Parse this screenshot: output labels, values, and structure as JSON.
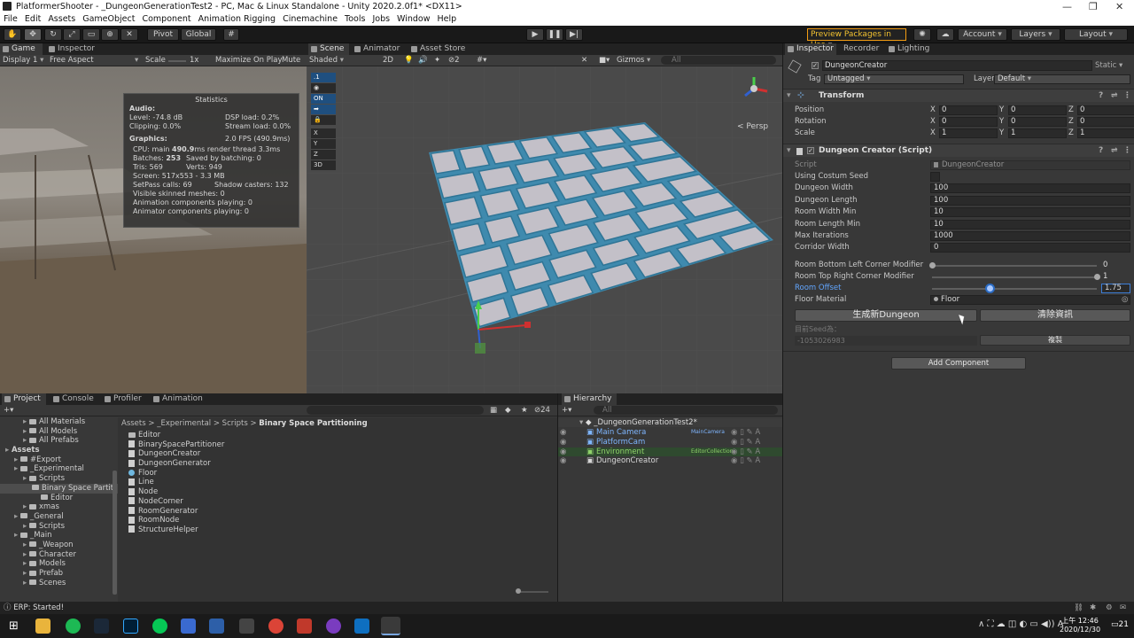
{
  "window": {
    "title": "PlatformerShooter - _DungeonGenerationTest2 - PC, Mac & Linux Standalone - Unity 2020.2.0f1* <DX11>"
  },
  "menu": [
    "File",
    "Edit",
    "Assets",
    "GameObject",
    "Component",
    "Animation Rigging",
    "Cinemachine",
    "Tools",
    "Jobs",
    "Window",
    "Help"
  ],
  "toolbar": {
    "pivot": "Pivot",
    "global": "Global",
    "preview": "Preview Packages in Use",
    "account": "Account",
    "layers": "Layers",
    "layout": "Layout"
  },
  "game": {
    "tabs": [
      "Game",
      "Inspector"
    ],
    "display": "Display 1",
    "aspect": "Free Aspect",
    "scale_label": "Scale",
    "scale_value": "1x",
    "maximize": "Maximize On Play",
    "mute": "Mute A",
    "stats": {
      "title": "Statistics",
      "audio": "Audio:",
      "level": "Level: -74.8 dB",
      "clipping": "Clipping: 0.0%",
      "dsp": "DSP load: 0.2%",
      "stream": "Stream load: 0.0%",
      "graphics": "Graphics:",
      "fps": "2.0 FPS (490.9ms)",
      "cpu_pre": "CPU: main ",
      "cpu_val": "490.9",
      "cpu_post": "ms  render thread 3.3ms",
      "batches_pre": "Batches: ",
      "batches_val": "253",
      "saved": "Saved by batching: 0",
      "tris": "Tris: 569",
      "verts": "Verts: 949",
      "screen": "Screen: 517x553 - 3.3 MB",
      "setpass": "SetPass calls: 69",
      "shadow": "Shadow casters: 132",
      "skinned": "Visible skinned meshes: 0",
      "anim1": "Animation components playing: 0",
      "anim2": "Animator components playing: 0"
    }
  },
  "scene": {
    "tabs": [
      "Scene",
      "Animator",
      "Asset Store"
    ],
    "shading": "Shaded",
    "mode2d": "2D",
    "layers_count": "2",
    "gizmos": "Gizmos",
    "search_placeholder": "All",
    "persp": "Persp",
    "overlay": [
      ".1",
      "",
      "ON",
      "",
      "X",
      "Y",
      "Z",
      "3D"
    ]
  },
  "inspector": {
    "tabs": [
      "Inspector",
      "Recorder",
      "Lighting"
    ],
    "object_name": "DungeonCreator",
    "static": "Static",
    "tag_label": "Tag",
    "tag": "Untagged",
    "layer_label": "Layer",
    "layer": "Default",
    "transform": {
      "title": "Transform",
      "position": "Position",
      "rotation": "Rotation",
      "scale": "Scale",
      "pos": [
        "0",
        "0",
        "0"
      ],
      "rot": [
        "0",
        "0",
        "0"
      ],
      "scl": [
        "1",
        "1",
        "1"
      ],
      "axes": [
        "X",
        "Y",
        "Z"
      ]
    },
    "script_component": {
      "title": "Dungeon Creator (Script)",
      "script_label": "Script",
      "script_value": "DungeonCreator",
      "fields": [
        {
          "label": "Using Costum Seed",
          "value": ""
        },
        {
          "label": "Dungeon Width",
          "value": "100"
        },
        {
          "label": "Dungeon Length",
          "value": "100"
        },
        {
          "label": "Room Width Min",
          "value": "10"
        },
        {
          "label": "Room Length Min",
          "value": "10"
        },
        {
          "label": "Max Iterations",
          "value": "1000"
        },
        {
          "label": "Corridor Width",
          "value": "0"
        }
      ],
      "slider1": {
        "label": "Room Bottom Left Corner Modifier",
        "value": "0",
        "level": 0
      },
      "slider2": {
        "label": "Room Top Right Corner Modifier",
        "value": "1",
        "level": 1
      },
      "slider3": {
        "label": "Room Offset",
        "value": "1.75",
        "level": 0.35
      },
      "floor_label": "Floor Material",
      "floor_value": "Floor",
      "generate": "生成新Dungeon",
      "clear": "清除資訊",
      "seed_label": "目前Seed為：",
      "seed_value": "-1053026983",
      "copy": "複製"
    },
    "add_component": "Add Component"
  },
  "project": {
    "tabs": [
      "Project",
      "Console",
      "Profiler",
      "Animation"
    ],
    "count": "24",
    "breadcrumb": [
      "Assets",
      "_Experimental",
      "Scripts",
      "Binary Space Partitioning"
    ],
    "tree": [
      {
        "t": "All Materials",
        "d": 2
      },
      {
        "t": "All Models",
        "d": 2
      },
      {
        "t": "All Prefabs",
        "d": 2
      },
      {
        "t": "Assets",
        "d": 0,
        "b": true
      },
      {
        "t": "#Export",
        "d": 1
      },
      {
        "t": "_Experimental",
        "d": 1
      },
      {
        "t": "Scripts",
        "d": 2
      },
      {
        "t": "Binary Space Partiti",
        "d": 3,
        "sel": true
      },
      {
        "t": "Editor",
        "d": 4
      },
      {
        "t": "xmas",
        "d": 2
      },
      {
        "t": "_General",
        "d": 1
      },
      {
        "t": "Scripts",
        "d": 2
      },
      {
        "t": "_Main",
        "d": 1
      },
      {
        "t": "_Weapon",
        "d": 2
      },
      {
        "t": "Character",
        "d": 2
      },
      {
        "t": "Models",
        "d": 2
      },
      {
        "t": "Prefab",
        "d": 2
      },
      {
        "t": "Scenes",
        "d": 2
      }
    ],
    "files": [
      {
        "t": "Editor",
        "k": "folder"
      },
      {
        "t": "BinarySpacePartitioner",
        "k": "script"
      },
      {
        "t": "DungeonCreator",
        "k": "script"
      },
      {
        "t": "DungeonGenerator",
        "k": "script"
      },
      {
        "t": "Floor",
        "k": "mat"
      },
      {
        "t": "Line",
        "k": "script"
      },
      {
        "t": "Node",
        "k": "script"
      },
      {
        "t": "NodeCorner",
        "k": "script"
      },
      {
        "t": "RoomGenerator",
        "k": "script"
      },
      {
        "t": "RoomNode",
        "k": "script"
      },
      {
        "t": "StructureHelper",
        "k": "script"
      }
    ]
  },
  "hierarchy": {
    "title": "Hierarchy",
    "search_placeholder": "All",
    "scene": "_DungeonGenerationTest2*",
    "items": [
      {
        "t": "Main Camera",
        "tag": "MainCamera",
        "c": "#7fb6ff"
      },
      {
        "t": "PlatformCam",
        "tag": "",
        "c": "#7fb6ff"
      },
      {
        "t": "Environment",
        "tag": "EditorCollection",
        "c": "#8fd36a"
      },
      {
        "t": "DungeonCreator",
        "tag": "",
        "c": "#d8d8d8"
      }
    ]
  },
  "status": {
    "message": "ERP: Started!"
  },
  "taskbar": {
    "time": "上午 12:46",
    "date": "2020/12/30",
    "notif": "21"
  }
}
